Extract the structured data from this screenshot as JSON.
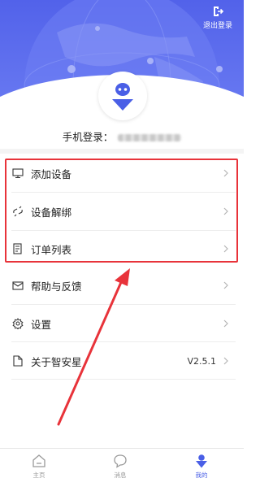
{
  "header": {
    "logout_label": "退出登录",
    "phone_label": "手机登录：",
    "phone_value_masked": "••••••••••"
  },
  "menu": {
    "add_device": "添加设备",
    "unbind_device": "设备解绑",
    "order_list": "订单列表",
    "help_feedback": "帮助与反馈",
    "settings": "设置",
    "about": "关于智安星",
    "version": "V2.5.1"
  },
  "nav": {
    "home": "主页",
    "messages": "消息",
    "mine": "我的"
  },
  "colors": {
    "header_blue": "#5262ea",
    "accent_blue": "#4a5fe6",
    "highlight_red": "#e8333a"
  },
  "icons": {
    "logout": "logout-icon",
    "avatar": "robot-avatar-icon",
    "add_device": "monitor-icon",
    "unbind_device": "unlink-icon",
    "order_list": "receipt-icon",
    "help_feedback": "mail-icon",
    "settings": "gear-icon",
    "about": "document-icon",
    "home": "home-icon",
    "messages": "chat-bubble-icon",
    "mine": "person-icon"
  }
}
